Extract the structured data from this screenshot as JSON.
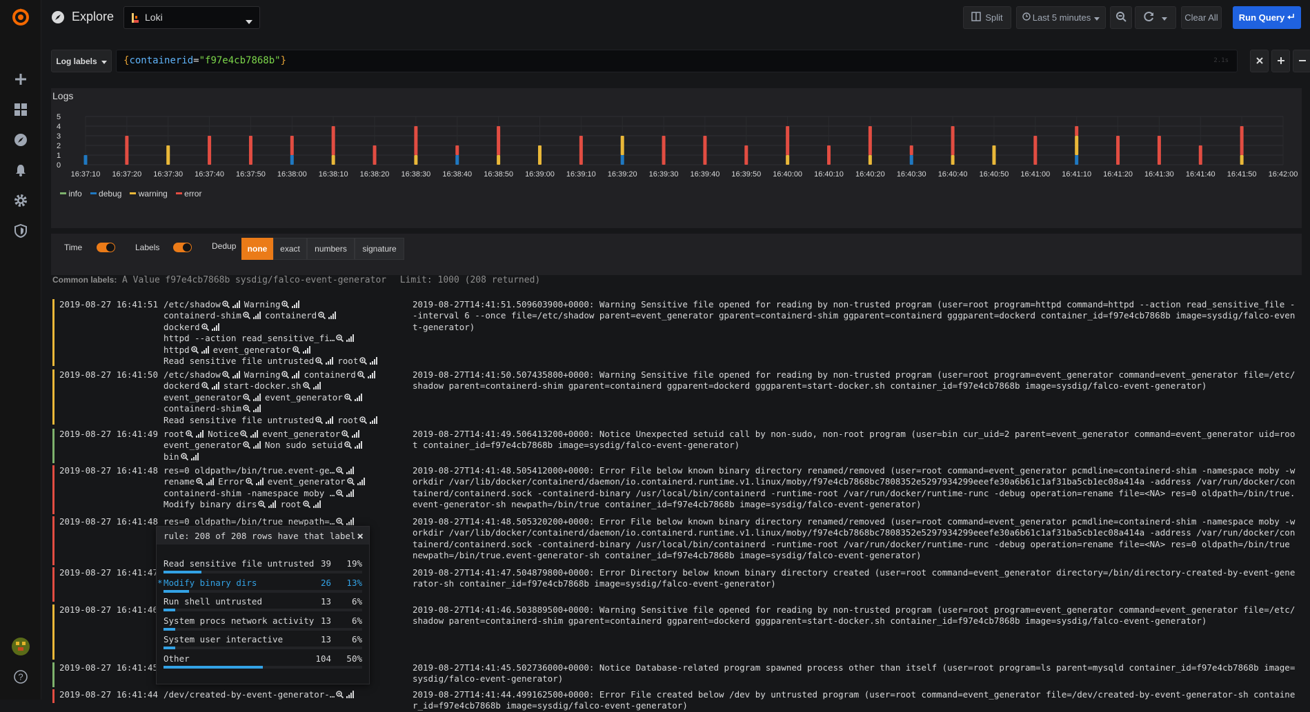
{
  "topbar": {
    "title": "Explore",
    "datasource": "Loki",
    "split_label": "Split",
    "time_range": "Last 5 minutes",
    "clear_all": "Clear All",
    "run_query": "Run Query"
  },
  "query": {
    "log_labels": "Log labels",
    "open_brace": "{",
    "key": "containerid",
    "eq": "=",
    "value": "\"f97e4cb7868b\"",
    "close_brace": "}",
    "hint": "2.1s"
  },
  "logs_panel": {
    "title": "Logs",
    "legend": [
      {
        "name": "info",
        "color": "#7eb26d"
      },
      {
        "name": "debug",
        "color": "#1f78c1"
      },
      {
        "name": "warning",
        "color": "#eab839"
      },
      {
        "name": "error",
        "color": "#e24d42"
      }
    ]
  },
  "chart_data": {
    "type": "bar",
    "stacked": true,
    "ylim": [
      0,
      5
    ],
    "y_ticks": [
      "5",
      "4",
      "3",
      "2",
      "1",
      "0"
    ],
    "x_ticks": [
      "16:37:10",
      "16:37:20",
      "16:37:30",
      "16:37:40",
      "16:37:50",
      "16:38:00",
      "16:38:10",
      "16:38:20",
      "16:38:30",
      "16:38:40",
      "16:38:50",
      "16:39:00",
      "16:39:10",
      "16:39:20",
      "16:39:30",
      "16:39:40",
      "16:39:50",
      "16:40:00",
      "16:40:10",
      "16:40:20",
      "16:40:30",
      "16:40:40",
      "16:40:50",
      "16:41:00",
      "16:41:10",
      "16:41:20",
      "16:41:30",
      "16:41:40",
      "16:41:50",
      "16:42:00"
    ],
    "categories": [
      "16:37:10",
      "16:37:20",
      "16:37:30",
      "16:37:40",
      "16:37:50",
      "16:38:00",
      "16:38:10",
      "16:38:20",
      "16:38:30",
      "16:38:40",
      "16:38:50",
      "16:39:00",
      "16:39:10",
      "16:39:20",
      "16:39:30",
      "16:39:40",
      "16:39:50",
      "16:40:00",
      "16:40:10",
      "16:40:20",
      "16:40:30",
      "16:40:40",
      "16:40:50",
      "16:41:00",
      "16:41:10",
      "16:41:20",
      "16:41:30",
      "16:41:40",
      "16:41:50"
    ],
    "series": [
      {
        "name": "info",
        "color": "#7eb26d",
        "values": [
          0,
          0,
          0,
          0,
          0,
          0,
          0,
          0,
          0,
          0,
          0,
          0,
          0,
          0,
          0,
          0,
          0,
          0,
          0,
          0,
          0,
          0,
          0,
          0,
          0,
          0,
          0,
          0,
          0
        ]
      },
      {
        "name": "debug",
        "color": "#1f78c1",
        "values": [
          1,
          0,
          0,
          0,
          0,
          1,
          0,
          0,
          0,
          1,
          0,
          0,
          0,
          1,
          0,
          0,
          0,
          0,
          0,
          0,
          1,
          0,
          0,
          0,
          1,
          0,
          0,
          0,
          0
        ]
      },
      {
        "name": "warning",
        "color": "#eab839",
        "values": [
          0,
          0,
          2,
          0,
          0,
          0,
          1,
          0,
          1,
          0,
          1,
          2,
          0,
          2,
          0,
          0,
          0,
          1,
          0,
          1,
          0,
          1,
          2,
          0,
          2,
          0,
          0,
          0,
          1
        ]
      },
      {
        "name": "error",
        "color": "#e24d42",
        "values": [
          0,
          3,
          0,
          3,
          3,
          2,
          3,
          2,
          3,
          1,
          3,
          0,
          3,
          0,
          3,
          3,
          2,
          3,
          2,
          3,
          1,
          3,
          0,
          3,
          1,
          3,
          3,
          2,
          3
        ]
      }
    ]
  },
  "options": {
    "time_label": "Time",
    "labels_label": "Labels",
    "dedup_label": "Dedup",
    "dedup_none": "none",
    "dedup_exact": "exact",
    "dedup_numbers": "numbers",
    "dedup_signature": "signature"
  },
  "common_labels": {
    "label": "Common labels:",
    "v1": "A Value",
    "v2": "f97e4cb7868b",
    "v3": "sysdig/falco-event-generator",
    "limit": "Limit: 1000 (208 returned)"
  },
  "rows": [
    {
      "level_color": "#eab839",
      "time": "2019-08-27 16:41:51",
      "labels": [
        [
          "/etc/shadow",
          "Warning"
        ],
        [
          "containerd-shim",
          "containerd"
        ],
        [
          "dockerd"
        ],
        [
          "httpd --action read_sensitive_fi…"
        ],
        [
          "httpd",
          "event_generator"
        ],
        [
          "Read sensitive file untrusted",
          "root"
        ]
      ],
      "msg": "2019-08-27T14:41:51.509603900+0000: Warning Sensitive file opened for reading by non-trusted program (user=root program=httpd command=httpd --action read_sensitive_file --interval 6 --once file=/etc/shadow parent=event_generator gparent=containerd-shim ggparent=containerd gggparent=dockerd container_id=f97e4cb7868b image=sysdig/falco-event-generator)"
    },
    {
      "level_color": "#eab839",
      "time": "2019-08-27 16:41:50",
      "labels": [
        [
          "/etc/shadow",
          "Warning",
          "containerd"
        ],
        [
          "dockerd",
          "start-docker.sh"
        ],
        [
          "event_generator",
          "event_generator"
        ],
        [
          "containerd-shim"
        ],
        [
          "Read sensitive file untrusted",
          "root"
        ]
      ],
      "msg": "2019-08-27T14:41:50.507435800+0000: Warning Sensitive file opened for reading by non-trusted program (user=root program=event_generator command=event_generator file=/etc/shadow parent=containerd-shim gparent=containerd ggparent=dockerd gggparent=start-docker.sh container_id=f97e4cb7868b image=sysdig/falco-event-generator)"
    },
    {
      "level_color": "#7eb26d",
      "time": "2019-08-27 16:41:49",
      "labels": [
        [
          "root",
          "Notice",
          "event_generator"
        ],
        [
          "event_generator",
          "Non sudo setuid"
        ],
        [
          "bin"
        ]
      ],
      "msg": "2019-08-27T14:41:49.506413200+0000: Notice Unexpected setuid call by non-sudo, non-root program (user=bin cur_uid=2 parent=event_generator command=event_generator uid=root container_id=f97e4cb7868b image=sysdig/falco-event-generator)"
    },
    {
      "level_color": "#e24d42",
      "time": "2019-08-27 16:41:48",
      "labels": [
        [
          "res=0 oldpath=/bin/true.event-ge…"
        ],
        [
          "rename",
          "Error",
          "event_generator"
        ],
        [
          "containerd-shim -namespace moby …"
        ],
        [
          "Modify binary dirs",
          "root"
        ]
      ],
      "msg": "2019-08-27T14:41:48.505412000+0000: Error File below known binary directory renamed/removed (user=root command=event_generator pcmdline=containerd-shim -namespace moby -workdir /var/lib/docker/containerd/daemon/io.containerd.runtime.v1.linux/moby/f97e4cb7868bc7808352e5297934299eeefe30a6b61c1af31ba5cb1ec08a414a -address /var/run/docker/containerd/containerd.sock -containerd-binary /usr/local/bin/containerd -runtime-root /var/run/docker/runtime-runc -debug operation=rename file=<NA> res=0 oldpath=/bin/true.event-generator-sh newpath=/bin/true container_id=f97e4cb7868b image=sysdig/falco-event-generator)"
    },
    {
      "level_color": "#e24d42",
      "time": "2019-08-27 16:41:48",
      "labels": [
        [
          "res=0 oldpath=/bin/true newpath=…"
        ]
      ],
      "msg": "2019-08-27T14:41:48.505320200+0000: Error File below known binary directory renamed/removed (user=root command=event_generator pcmdline=containerd-shim -namespace moby -workdir /var/lib/docker/containerd/daemon/io.containerd.runtime.v1.linux/moby/f97e4cb7868bc7808352e5297934299eeefe30a6b61c1af31ba5cb1ec08a414a -address /var/run/docker/containerd/containerd.sock -containerd-binary /usr/local/bin/containerd -runtime-root /var/run/docker/runtime-runc -debug operation=rename file=<NA> res=0 oldpath=/bin/true newpath=/bin/true.event-generator-sh container_id=f97e4cb7868b image=sysdig/falco-event-generator)"
    },
    {
      "level_color": "#e24d42",
      "time": "2019-08-27 16:41:47",
      "labels": [],
      "msg": "2019-08-27T14:41:47.504879800+0000: Error Directory below known binary directory created (user=root command=event_generator directory=/bin/directory-created-by-event-generator-sh container_id=f97e4cb7868b image=sysdig/falco-event-generator)"
    },
    {
      "level_color": "#eab839",
      "time": "2019-08-27 16:41:46",
      "labels": [],
      "msg": "2019-08-27T14:41:46.503889500+0000: Warning Sensitive file opened for reading by non-trusted program (user=root program=event_generator command=event_generator file=/etc/shadow parent=containerd-shim gparent=containerd ggparent=dockerd gggparent=start-docker.sh container_id=f97e4cb7868b image=sysdig/falco-event-generator)"
    },
    {
      "level_color": "#7eb26d",
      "time": "2019-08-27 16:41:45",
      "labels": [],
      "msg": "2019-08-27T14:41:45.502736000+0000: Notice Database-related program spawned process other than itself (user=root program=ls parent=mysqld container_id=f97e4cb7868b image=sysdig/falco-event-generator)"
    },
    {
      "level_color": "#e24d42",
      "time": "2019-08-27 16:41:44",
      "labels": [
        [
          "/dev/created-by-event-generator-…"
        ]
      ],
      "msg": "2019-08-27T14:41:44.499162500+0000: Error File created below /dev by untrusted program (user=root command=event_generator file=/dev/created-by-event-generator-sh container_id=f97e4cb7868b image=sysdig/falco-event-generator)"
    }
  ],
  "popup": {
    "title": "rule: 208 of 208 rows have that label",
    "close": "×",
    "stats": [
      {
        "label": "Read sensitive file untrusted",
        "count": "39",
        "pct": "19%",
        "fraction": 0.19,
        "active": false
      },
      {
        "label": "Modify binary dirs",
        "count": "26",
        "pct": "13%",
        "fraction": 0.13,
        "active": true
      },
      {
        "label": "Run shell untrusted",
        "count": "13",
        "pct": "6%",
        "fraction": 0.06,
        "active": false
      },
      {
        "label": "System procs network activity",
        "count": "13",
        "pct": "6%",
        "fraction": 0.06,
        "active": false
      },
      {
        "label": "System user interactive",
        "count": "13",
        "pct": "6%",
        "fraction": 0.06,
        "active": false
      },
      {
        "label": "Other",
        "count": "104",
        "pct": "50%",
        "fraction": 0.5,
        "active": false
      }
    ]
  }
}
